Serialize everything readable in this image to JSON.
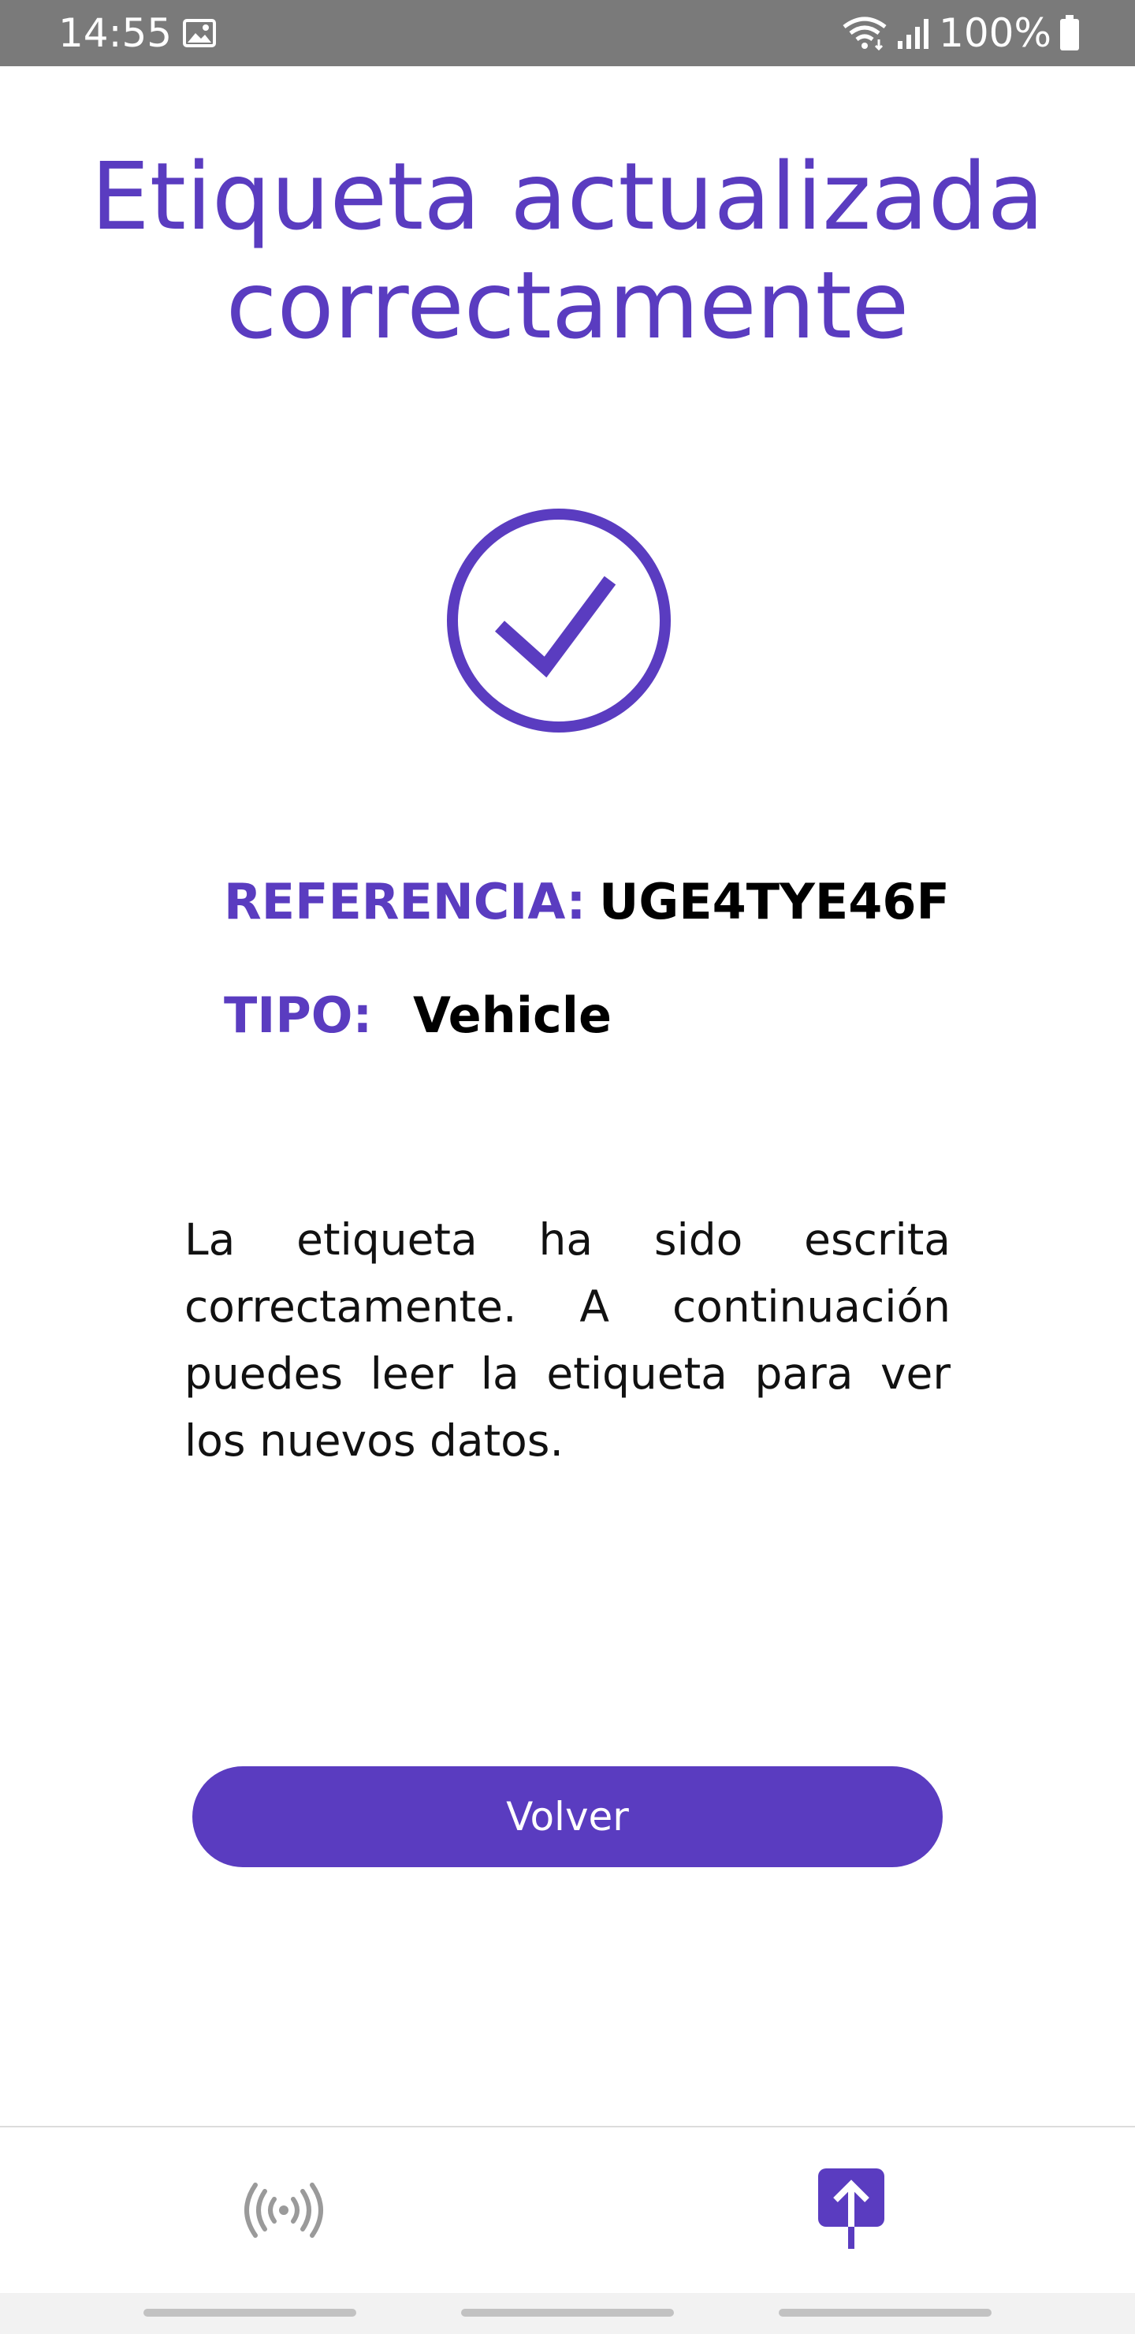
{
  "status_bar": {
    "time": "14:55",
    "battery": "100%",
    "icons": [
      "image-icon",
      "wifi-icon",
      "signal-icon",
      "battery-icon"
    ]
  },
  "screen": {
    "title_line1": "Etiqueta actualizada",
    "title_line2": "correctamente",
    "status_icon": "check-circle-icon",
    "info": {
      "reference_label": "REFERENCIA:",
      "reference_value": "UGE4TYE46F",
      "type_label": "TIPO:",
      "type_value": "Vehicle"
    },
    "description": "La etiqueta ha sido escrita correctamente. A continuación puedes leer la etiqueta para ver los nuevos datos.",
    "button_label": "Volver"
  },
  "bottom_nav": {
    "items": [
      {
        "icon": "nfc-read-icon",
        "active": false
      },
      {
        "icon": "upload-write-icon",
        "active": true
      }
    ]
  },
  "colors": {
    "accent": "#5a3cc0",
    "status_bar": "#7a7a7a",
    "inactive_icon": "#9a9a9a"
  }
}
